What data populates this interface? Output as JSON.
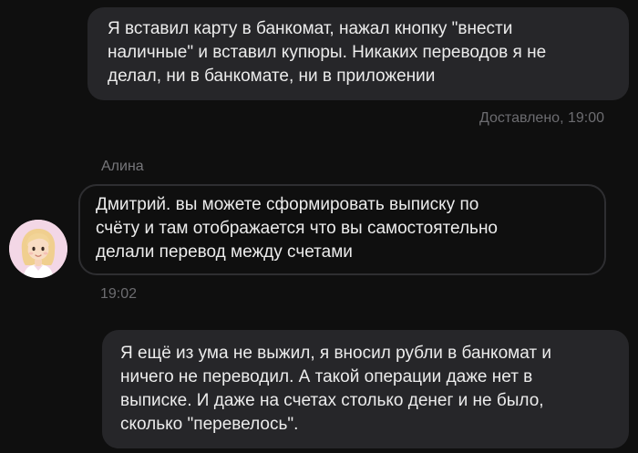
{
  "messages": [
    {
      "direction": "outgoing",
      "text": "Я вставил карту в банкомат, нажал кнопку \"внести\nналичные\" и вставил купюры. Никаких переводов я не\nделал, ни в банкомате, ни в приложении",
      "status": "Доставлено, 19:00"
    },
    {
      "direction": "incoming",
      "sender": "Алина",
      "avatar_icon": "agent-avatar-girl",
      "text": "Дмитрий. вы можете сформировать выписку по\nсчёту и там отображается что вы самостоятельно\nделали перевод между счетами",
      "time": "19:02"
    },
    {
      "direction": "outgoing",
      "text": "Я ещё из ума не выжил, я вносил рубли в банкомат и\nничего не переводил. А такой операции даже нет в\nвыписке. И даже на счетах столько денег и не было,\nсколько \"перевелось\"."
    }
  ],
  "colors": {
    "background": "#0f0f0f",
    "outgoing_bubble": "#262629",
    "incoming_border": "#2e2e31",
    "meta_text": "#6c6c70",
    "avatar_bg": "#f3d7e6"
  }
}
